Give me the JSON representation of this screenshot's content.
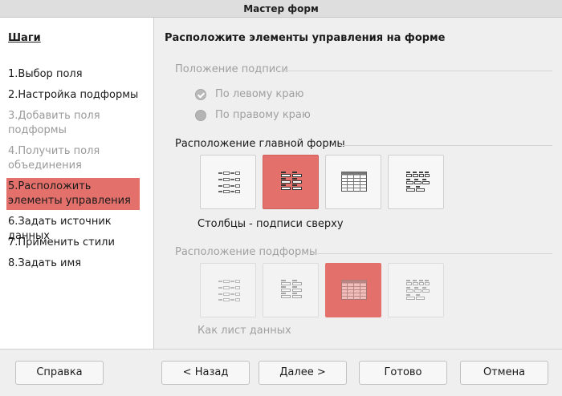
{
  "window": {
    "title": "Мастер форм"
  },
  "sidebar": {
    "title": "Шаги",
    "steps": [
      {
        "label": "1.Выбор поля",
        "state": "normal"
      },
      {
        "label": "2.Настройка подформы",
        "state": "normal"
      },
      {
        "label": "3.Добавить поля подформы",
        "state": "disabled"
      },
      {
        "label": "4.Получить поля объединения",
        "state": "disabled"
      },
      {
        "label": "5.Расположить элементы управления",
        "state": "active"
      },
      {
        "label": "6.Задать источник данных",
        "state": "normal"
      },
      {
        "label": "7.Применить стили",
        "state": "normal"
      },
      {
        "label": "8.Задать имя",
        "state": "normal"
      }
    ]
  },
  "main": {
    "title": "Расположите элементы управления на форме",
    "label_position": {
      "heading": "Положение подписи",
      "options": [
        {
          "label": "По левому краю",
          "checked": true
        },
        {
          "label": "По правому краю",
          "checked": false
        }
      ]
    },
    "main_form": {
      "heading": "Расположение главной формы",
      "layouts": [
        {
          "icon": "columns-labels-left-icon",
          "selected": false
        },
        {
          "icon": "columns-labels-top-icon",
          "selected": true
        },
        {
          "icon": "datasheet-icon",
          "selected": false
        },
        {
          "icon": "blocks-labels-above-icon",
          "selected": false
        }
      ],
      "caption": "Столбцы - подписи сверху"
    },
    "subform": {
      "heading": "Расположение подформы",
      "layouts": [
        {
          "icon": "columns-labels-left-icon",
          "selected": false
        },
        {
          "icon": "columns-labels-top-icon",
          "selected": false
        },
        {
          "icon": "datasheet-icon",
          "selected": true
        },
        {
          "icon": "blocks-labels-above-icon",
          "selected": false
        }
      ],
      "caption": "Как лист данных"
    }
  },
  "footer": {
    "help": "Справка",
    "back": "< Назад",
    "next": "Далее >",
    "finish": "Готово",
    "cancel": "Отмена"
  },
  "colors": {
    "accent": "#e4706c",
    "disabled_text": "#a0a0a0"
  }
}
